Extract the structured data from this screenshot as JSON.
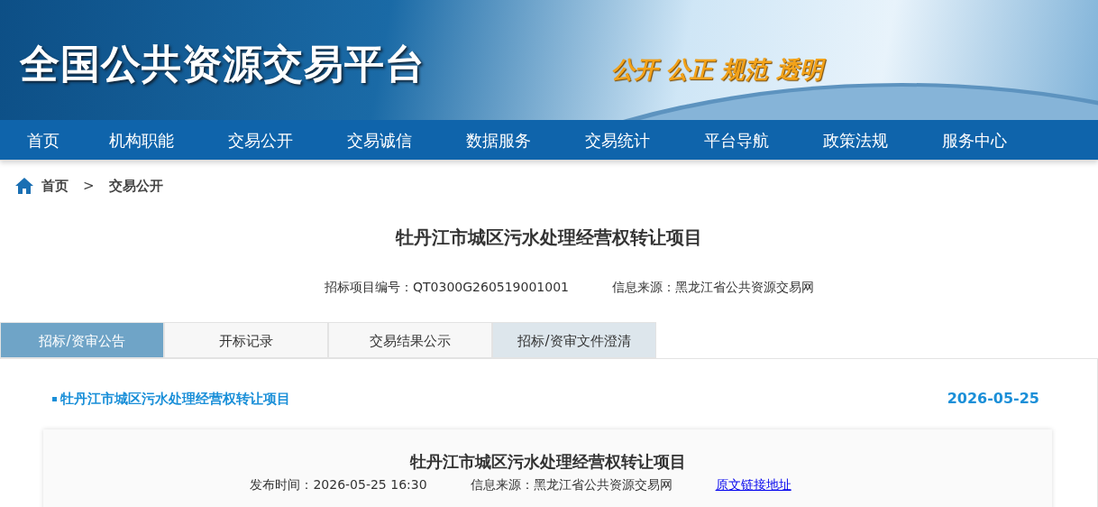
{
  "banner": {
    "title": "全国公共资源交易平台",
    "slogan": "公开 公正 规范 透明"
  },
  "nav": [
    "首页",
    "机构职能",
    "交易公开",
    "交易诚信",
    "数据服务",
    "交易统计",
    "平台导航",
    "政策法规",
    "服务中心"
  ],
  "breadcrumb": {
    "items": [
      "首页",
      "交易公开"
    ],
    "separator": ">"
  },
  "project": {
    "title": "牡丹江市城区污水处理经营权转让项目",
    "code_label": "招标项目编号：",
    "code": "QT0300G260519001001",
    "source_label": "信息来源：",
    "source": "黑龙江省公共资源交易网"
  },
  "tabs": [
    {
      "label": "招标/资审公告",
      "selected": true,
      "hovered": false
    },
    {
      "label": "开标记录",
      "selected": false,
      "hovered": false
    },
    {
      "label": "交易结果公示",
      "selected": false,
      "hovered": false
    },
    {
      "label": "招标/资审文件澄清",
      "selected": false,
      "hovered": true
    }
  ],
  "notice": {
    "title": "牡丹江市城区污水处理经营权转让项目",
    "date": "2026-05-25"
  },
  "article": {
    "title": "牡丹江市城区污水处理经营权转让项目",
    "time_label": "发布时间：",
    "time": "2026-05-25 16:30",
    "source_label": "信息来源：",
    "source": "黑龙江省公共资源交易网",
    "link": "原文链接地址"
  }
}
